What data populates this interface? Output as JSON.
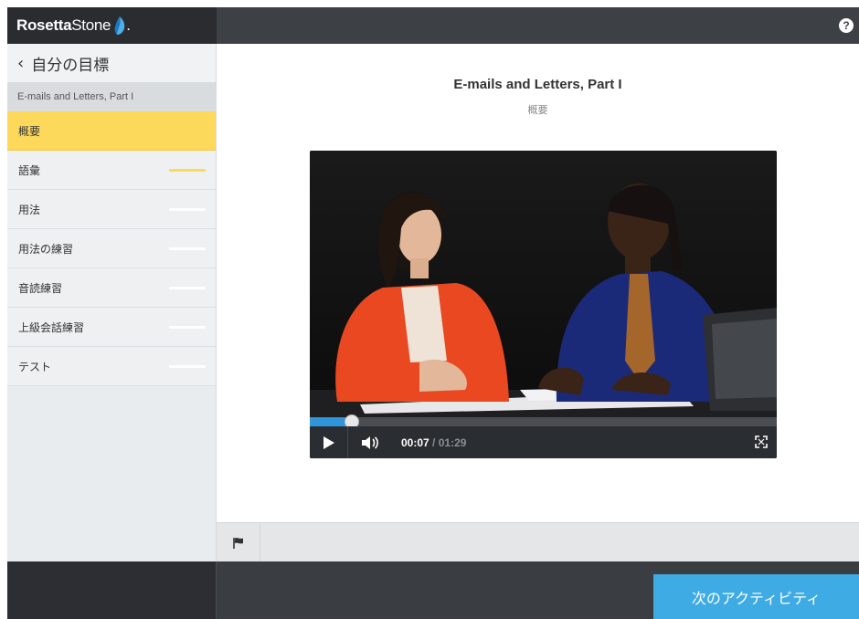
{
  "header": {
    "logo_bold": "Rosetta",
    "logo_light": "Stone",
    "logo_dot": ".",
    "help_label": "?"
  },
  "sidebar": {
    "back_label": "自分の目標",
    "unit_title": "E-mails and Letters, Part I",
    "items": [
      {
        "label": "概要",
        "state": "active"
      },
      {
        "label": "語彙",
        "state": "in-progress"
      },
      {
        "label": "用法",
        "state": "not-started"
      },
      {
        "label": "用法の練習",
        "state": "not-started"
      },
      {
        "label": "音読練習",
        "state": "not-started"
      },
      {
        "label": "上級会話練習",
        "state": "not-started"
      },
      {
        "label": "テスト",
        "state": "not-started"
      }
    ]
  },
  "main": {
    "title": "E-mails and Letters, Part I",
    "subtitle": "概要",
    "video": {
      "current_time": "00:07",
      "separator": " / ",
      "duration": "01:29",
      "progress_fraction": 0.09,
      "play_icon": "play-icon",
      "volume_icon": "volume-icon",
      "fullscreen_icon": "fullscreen-icon"
    }
  },
  "footer": {
    "flag_icon": "flag-icon",
    "next_label": "次のアクティビティ"
  },
  "colors": {
    "accent_yellow": "#fcd95b",
    "accent_blue": "#3eabe5",
    "progress_blue": "#2f96db",
    "dark_bar": "#3d4045"
  }
}
